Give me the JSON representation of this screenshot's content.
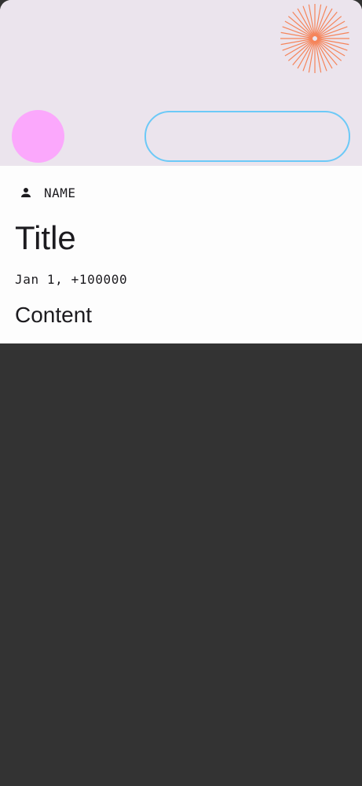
{
  "card": {
    "author": {
      "icon": "person-icon",
      "name": "NAME"
    },
    "title": "Title",
    "date": "Jan 1, +100000",
    "content": "Content"
  },
  "colors": {
    "header_background": "#ebe4ed",
    "avatar": "#fba8fc",
    "button_outline": "#6cc9f7",
    "sunburst": "#f5845a",
    "card_background": "#fdfdfd",
    "page_background": "#333333",
    "text": "#1c1b1f"
  },
  "icons": {
    "header_decoration": "sunburst-icon",
    "author": "person-icon"
  }
}
